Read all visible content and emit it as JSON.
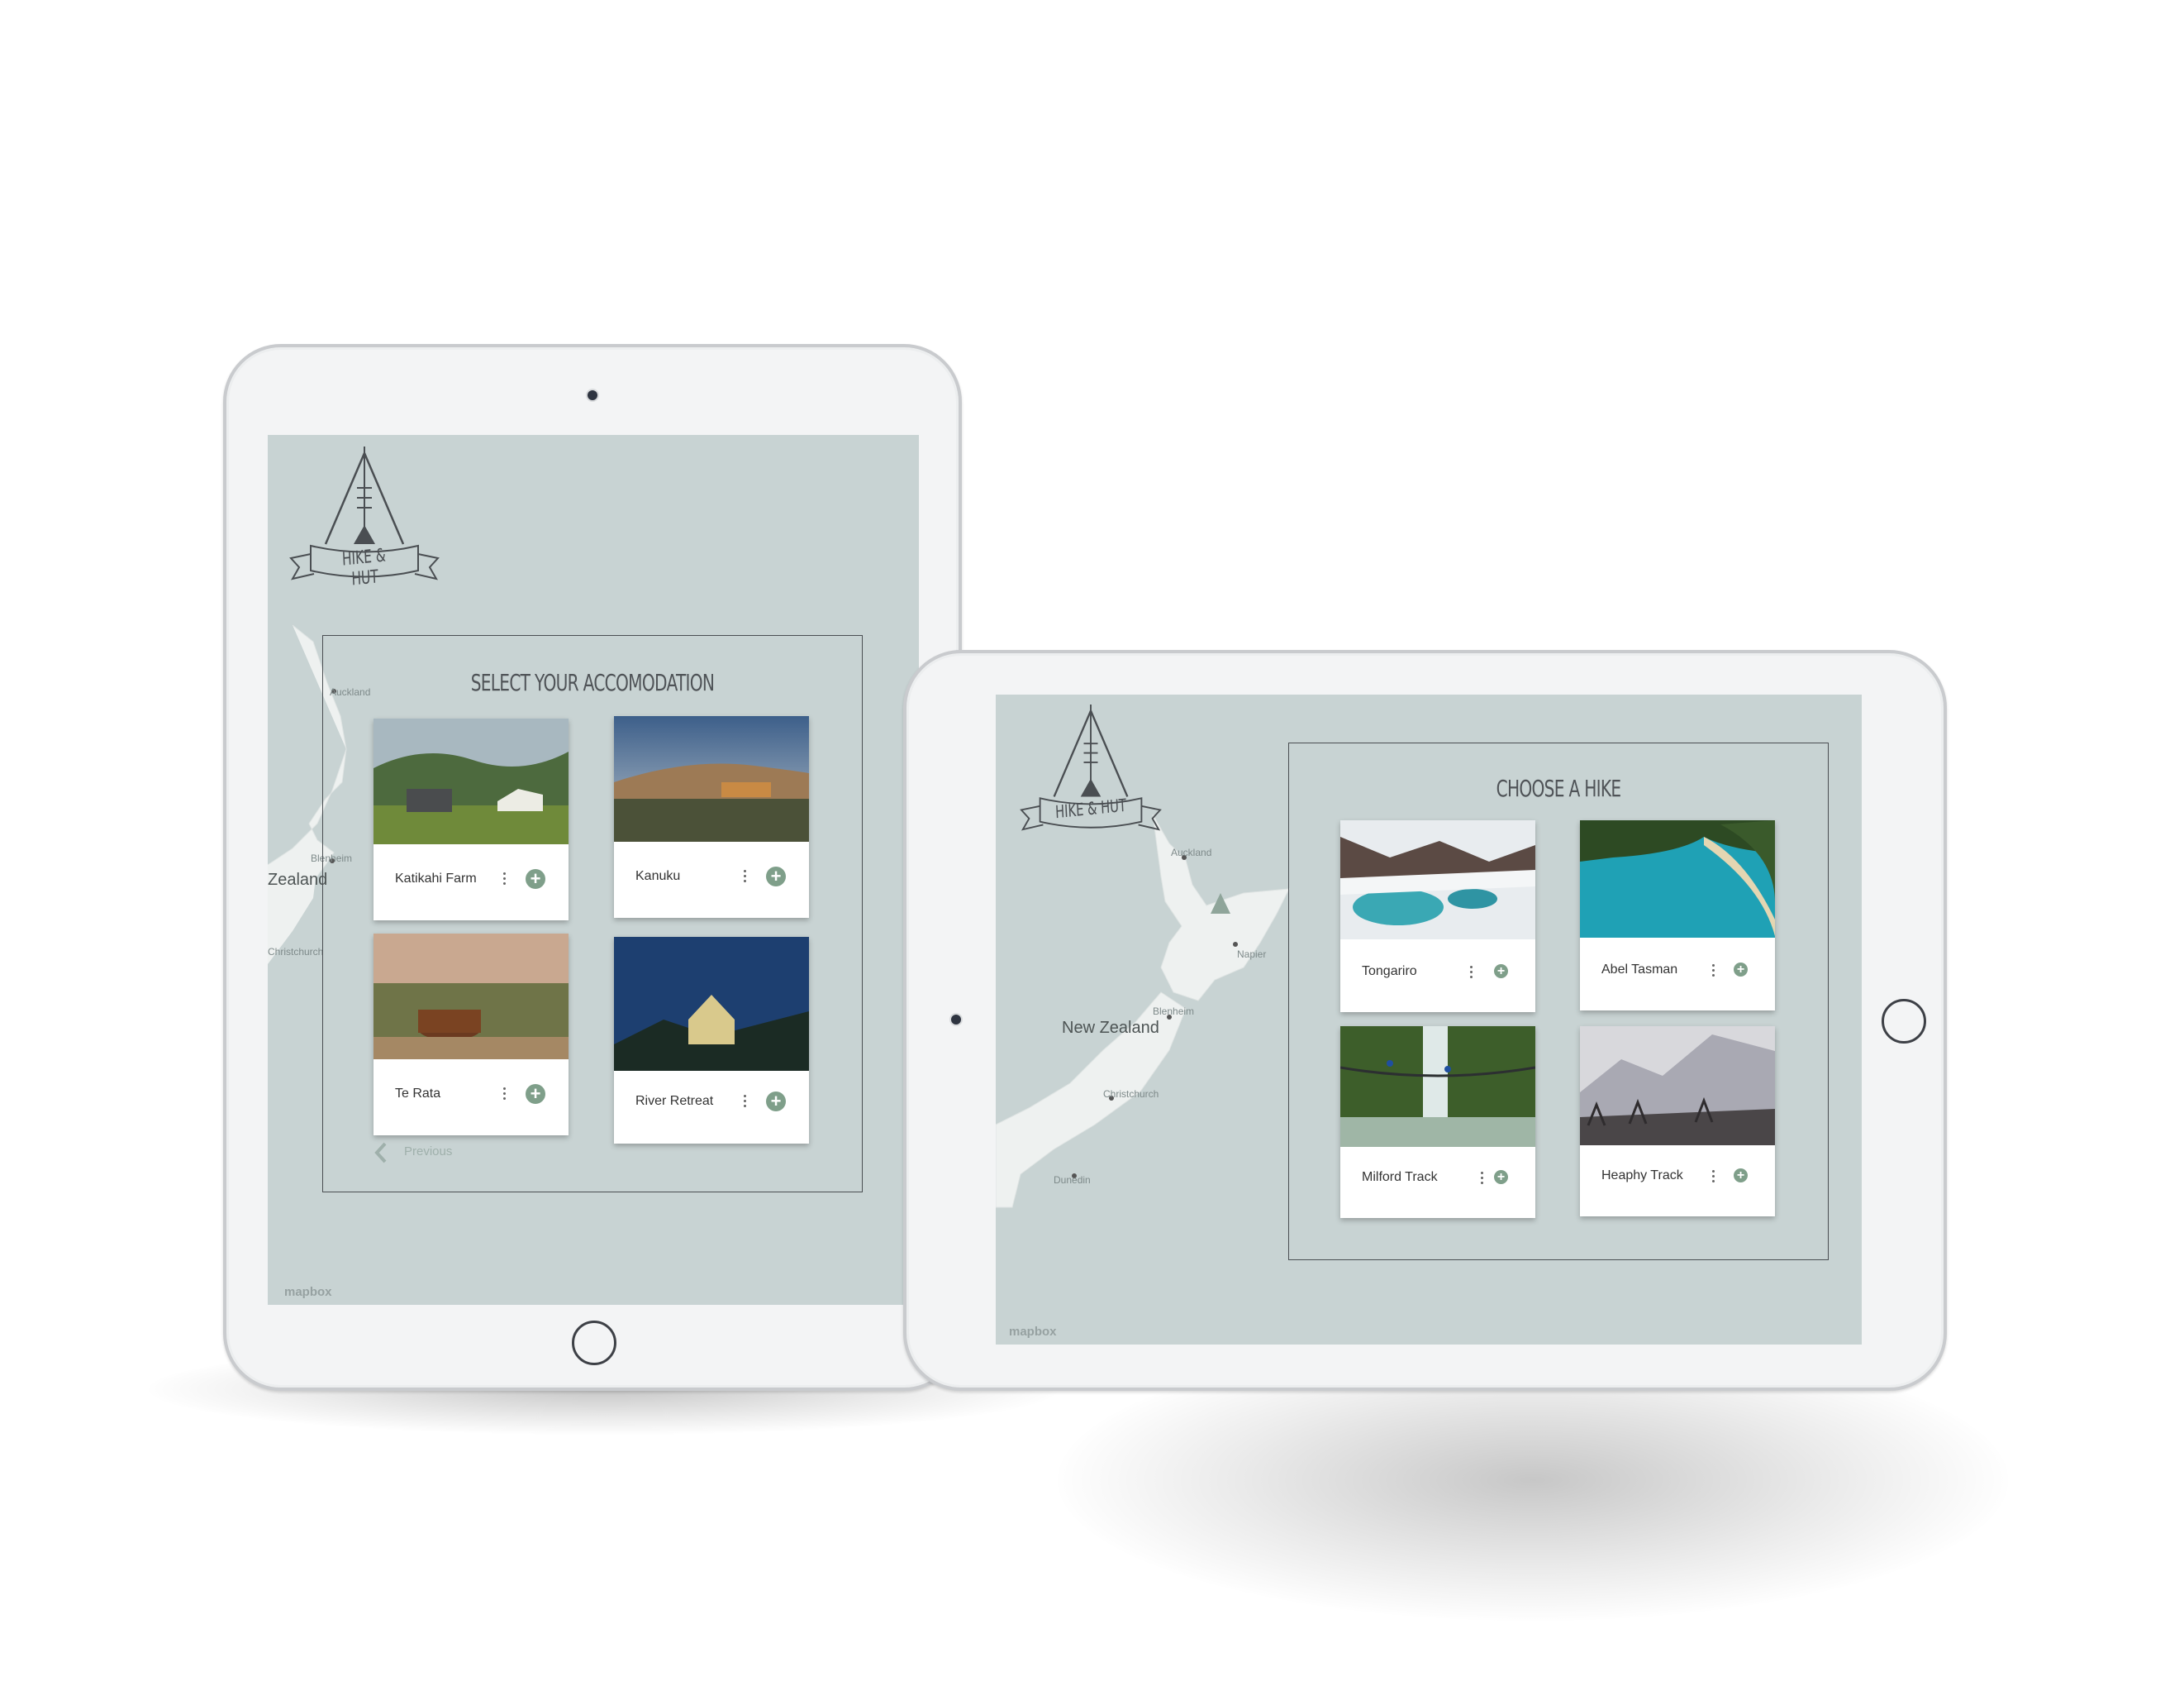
{
  "brand": {
    "logo_text": "HIKE & HUT"
  },
  "accommodation_screen": {
    "title": "SELECT YOUR ACCOMODATION",
    "cards": [
      {
        "label": "Katikahi Farm"
      },
      {
        "label": "Kanuku"
      },
      {
        "label": "Te Rata"
      },
      {
        "label": "River Retreat"
      }
    ],
    "previous_label": "Previous",
    "map_labels": {
      "city1": "Auckland",
      "city2": "Blenheim",
      "region": "Zealand",
      "city3": "Christchurch"
    },
    "attribution": "mapbox"
  },
  "hike_screen": {
    "title": "CHOOSE A HIKE",
    "cards": [
      {
        "label": "Tongariro"
      },
      {
        "label": "Abel Tasman"
      },
      {
        "label": "Milford Track"
      },
      {
        "label": "Heaphy Track"
      }
    ],
    "map_labels": {
      "city1": "Auckland",
      "city2": "Napier",
      "country": "New Zealand",
      "city3": "Blenheim",
      "city4": "Christchurch",
      "city5": "Dunedin"
    },
    "attribution": "mapbox"
  },
  "icons": {
    "add": "plus-circle-icon",
    "more": "kebab-icon",
    "back": "chevron-left-icon",
    "logo": "teepee-icon"
  },
  "colors": {
    "map_bg": "#c8d3d3",
    "accent": "#7f9f8a",
    "frame": "#f3f4f5"
  }
}
